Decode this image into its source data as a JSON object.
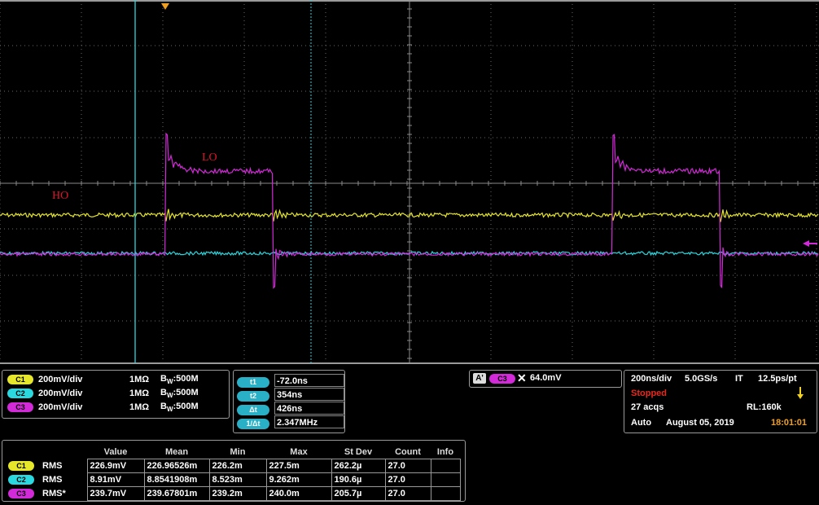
{
  "trigger_marker_color": "#f0a020",
  "labels": {
    "lo": "LO",
    "ho": "HO"
  },
  "channels": [
    {
      "id": "C1",
      "scale": "200mV/div",
      "impedance": "1MΩ",
      "bw_prefix": "B",
      "bw_sup": "W",
      "bw": ":500M",
      "color": "#e6e62a"
    },
    {
      "id": "C2",
      "scale": "200mV/div",
      "impedance": "1MΩ",
      "bw_prefix": "B",
      "bw_sup": "W",
      "bw": ":500M",
      "color": "#2ad8e0"
    },
    {
      "id": "C3",
      "scale": "200mV/div",
      "impedance": "1MΩ",
      "bw_prefix": "B",
      "bw_sup": "W",
      "bw": ":500M",
      "color": "#d22ad8"
    }
  ],
  "cursors": [
    {
      "label": "t1",
      "value": "-72.0ns"
    },
    {
      "label": "t2",
      "value": "354ns"
    },
    {
      "label": "Δt",
      "value": "426ns"
    },
    {
      "label": "1/Δt",
      "value": "2.347MHz"
    }
  ],
  "trigger": {
    "mode_label": "A'",
    "channel": "C3",
    "slope_icon": "slope-x-icon",
    "level": "64.0mV"
  },
  "acquisition": {
    "timebase": "200ns/div",
    "sample_rate": "5.0GS/s",
    "it_label": "IT",
    "resolution": "12.5ps/pt",
    "status": "Stopped",
    "acqs": "27 acqs",
    "record_length": "RL:160k",
    "mode": "Auto",
    "date": "August 05, 2019",
    "time": "18:01:01"
  },
  "measurements": {
    "headers": [
      "Value",
      "Mean",
      "Min",
      "Max",
      "St Dev",
      "Count",
      "Info"
    ],
    "rows": [
      {
        "channel": "C1",
        "type": "RMS",
        "value": "226.9mV",
        "mean": "226.96526m",
        "min": "226.2m",
        "max": "227.5m",
        "stdev": "262.2µ",
        "count": "27.0",
        "info": ""
      },
      {
        "channel": "C2",
        "type": "RMS",
        "value": "8.91mV",
        "mean": "8.8541908m",
        "min": "8.523m",
        "max": "9.262m",
        "stdev": "190.6µ",
        "count": "27.0",
        "info": ""
      },
      {
        "channel": "C3",
        "type": "RMS*",
        "value": "239.7mV",
        "mean": "239.67801m",
        "min": "239.2m",
        "max": "240.0m",
        "stdev": "205.7µ",
        "count": "27.0",
        "info": ""
      }
    ]
  }
}
